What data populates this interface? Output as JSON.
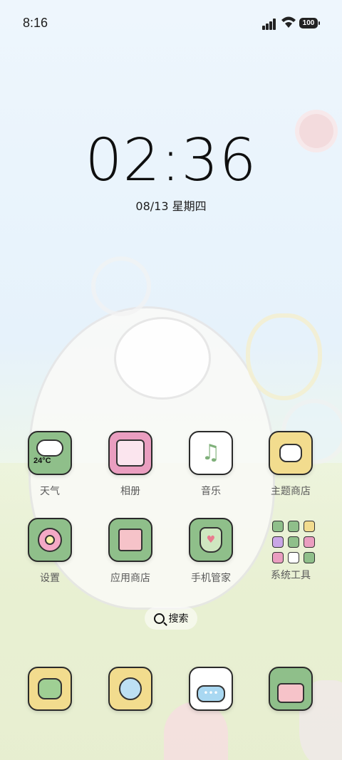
{
  "status_bar": {
    "time": "8:16",
    "battery": "100"
  },
  "lock": {
    "clock": "02:36",
    "date": "08/13 星期四"
  },
  "apps_row1": [
    {
      "label": "天气",
      "icon": "weather-icon",
      "temp": "24°C",
      "bg": "#8fbf8a"
    },
    {
      "label": "相册",
      "icon": "gallery-icon",
      "bg": "#ea9ec0"
    },
    {
      "label": "音乐",
      "icon": "music-icon",
      "bg": "#ffffff"
    },
    {
      "label": "主题商店",
      "icon": "theme-store-icon",
      "bg": "#f2dc8e"
    }
  ],
  "apps_row2": [
    {
      "label": "设置",
      "icon": "settings-icon",
      "bg": "#8fbf8a"
    },
    {
      "label": "应用商店",
      "icon": "app-store-icon",
      "bg": "#8fbf8a"
    },
    {
      "label": "手机管家",
      "icon": "security-icon",
      "bg": "#8fbf8a"
    },
    {
      "label": "系统工具",
      "icon": "system-tools-folder"
    }
  ],
  "search": {
    "label": "搜索"
  },
  "dock": [
    {
      "icon": "phone-icon",
      "bg": "#f2dc8e"
    },
    {
      "icon": "browser-icon",
      "bg": "#f2dc8e"
    },
    {
      "icon": "messages-icon",
      "bg": "#ffffff"
    },
    {
      "icon": "camera-icon",
      "bg": "#8fbf8a"
    }
  ]
}
